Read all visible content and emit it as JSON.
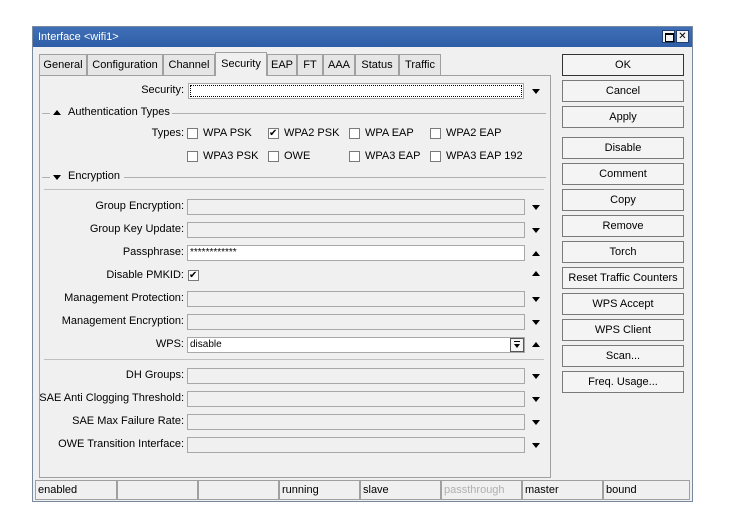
{
  "window": {
    "title": "Interface <wifi1>",
    "maximize_label": "",
    "close_label": "✕"
  },
  "tabs": [
    "General",
    "Configuration",
    "Channel",
    "Security",
    "EAP",
    "FT",
    "AAA",
    "Status",
    "Traffic"
  ],
  "form": {
    "security_label": "Security:",
    "security_value": "",
    "auth_section": "Authentication Types",
    "types_label": "Types:",
    "types": [
      {
        "label": "WPA PSK",
        "checked": false
      },
      {
        "label": "WPA2 PSK",
        "checked": true
      },
      {
        "label": "WPA EAP",
        "checked": false
      },
      {
        "label": "WPA2 EAP",
        "checked": false
      },
      {
        "label": "WPA3 PSK",
        "checked": false
      },
      {
        "label": "OWE",
        "checked": false
      },
      {
        "label": "WPA3 EAP",
        "checked": false
      },
      {
        "label": "WPA3 EAP 192",
        "checked": false
      }
    ],
    "encryption_section": "Encryption",
    "group_encryption_label": "Group Encryption:",
    "group_encryption_value": "",
    "group_key_update_label": "Group Key Update:",
    "group_key_update_value": "",
    "passphrase_label": "Passphrase:",
    "passphrase_value": "************",
    "disable_pmkid_label": "Disable PMKID:",
    "disable_pmkid_checked": true,
    "mgmt_protection_label": "Management Protection:",
    "mgmt_protection_value": "",
    "mgmt_encryption_label": "Management Encryption:",
    "mgmt_encryption_value": "",
    "wps_label": "WPS:",
    "wps_value": "disable",
    "dh_groups_label": "DH Groups:",
    "dh_groups_value": "",
    "sae_anti_clogging_label": "SAE Anti Clogging Threshold:",
    "sae_anti_clogging_value": "",
    "sae_max_failure_label": "SAE Max Failure Rate:",
    "sae_max_failure_value": "",
    "owe_transition_label": "OWE Transition Interface:",
    "owe_transition_value": ""
  },
  "buttons": [
    "OK",
    "Cancel",
    "Apply",
    "Disable",
    "Comment",
    "Copy",
    "Remove",
    "Torch",
    "Reset Traffic Counters",
    "WPS Accept",
    "WPS Client",
    "Scan...",
    "Freq. Usage..."
  ],
  "status": [
    "enabled",
    "",
    "",
    "running",
    "slave",
    "passthrough",
    "master",
    "bound"
  ],
  "colors": {
    "titlebar": "#2f5ea8",
    "window_bg": "#f0f0f0",
    "dim_text": "#b0b0b0"
  }
}
